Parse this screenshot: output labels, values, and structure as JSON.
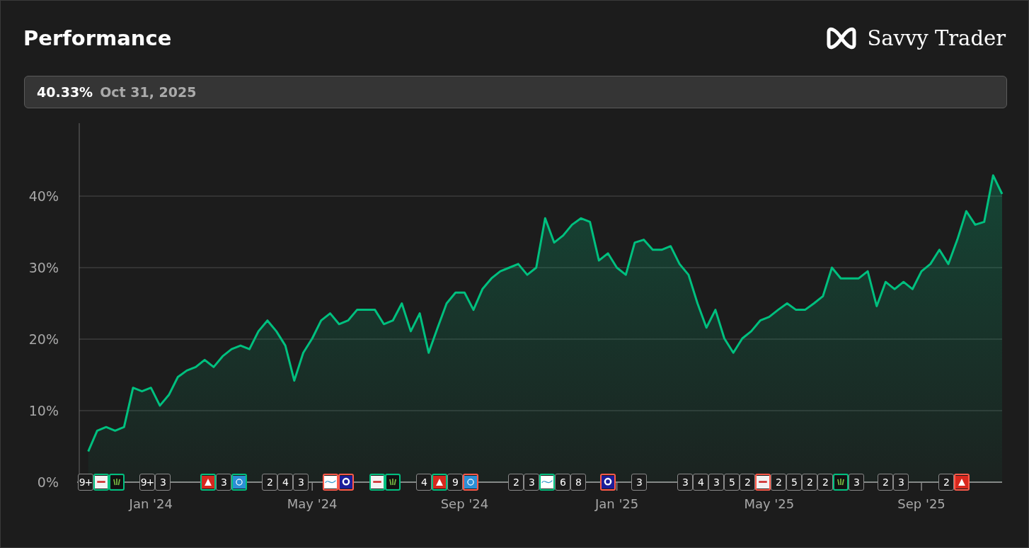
{
  "header": {
    "title": "Performance",
    "brand": "Savvy Trader"
  },
  "summary": {
    "value": "40.33%",
    "date": "Oct 31, 2025"
  },
  "chart": {
    "chart_data": {
      "type": "area",
      "grid": true,
      "ylim": [
        0,
        50
      ],
      "yticks": [
        {
          "value": 0,
          "label": "0%"
        },
        {
          "value": 10,
          "label": "10%"
        },
        {
          "value": 20,
          "label": "20%"
        },
        {
          "value": 30,
          "label": "30%"
        },
        {
          "value": 40,
          "label": "40%"
        }
      ],
      "categories": [
        null,
        null,
        null,
        null,
        null,
        null,
        null,
        null,
        "Jan '24",
        null,
        null,
        null,
        null,
        null,
        null,
        null,
        null,
        null,
        null,
        null,
        null,
        null,
        null,
        null,
        null,
        null,
        "May '24",
        null,
        null,
        null,
        null,
        null,
        null,
        null,
        null,
        null,
        null,
        null,
        null,
        null,
        null,
        null,
        null,
        "Sep '24",
        null,
        null,
        null,
        null,
        null,
        null,
        null,
        null,
        null,
        null,
        null,
        null,
        null,
        null,
        null,
        null,
        "Jan '25",
        null,
        null,
        null,
        null,
        null,
        null,
        null,
        null,
        null,
        null,
        null,
        null,
        null,
        null,
        null,
        null,
        "May '25",
        null,
        null,
        null,
        null,
        null,
        null,
        null,
        null,
        null,
        null,
        null,
        null,
        null,
        null,
        null,
        null,
        "Sep '25",
        null,
        null,
        null,
        null,
        null,
        null,
        null,
        null,
        null
      ],
      "series": [
        {
          "color": "#00c07f",
          "values": [
            null,
            4.3,
            7.2,
            7.7,
            7.2,
            7.7,
            13.2,
            12.7,
            13.2,
            10.7,
            12.2,
            14.7,
            15.6,
            16.1,
            17.1,
            16.1,
            17.6,
            18.6,
            19.1,
            18.6,
            21.1,
            22.6,
            21.1,
            19.1,
            14.2,
            18.1,
            20.1,
            22.6,
            23.6,
            22.1,
            22.6,
            24.1,
            24.1,
            24.1,
            22.1,
            22.6,
            25,
            21.1,
            23.6,
            18.1,
            21.6,
            25,
            26.5,
            26.5,
            24.1,
            27,
            28.5,
            29.5,
            30,
            30.5,
            29,
            30,
            36.9,
            33.5,
            34.5,
            36,
            36.9,
            36.4,
            31,
            32,
            30,
            29,
            33.5,
            33.9,
            32.5,
            32.5,
            33,
            30.5,
            29,
            25,
            21.6,
            24.1,
            20.1,
            18.1,
            20.1,
            21.1,
            22.6,
            23.1,
            24.1,
            25,
            24.1,
            24.1,
            25,
            26,
            30,
            28.5,
            28.5,
            28.5,
            29.5,
            24.6,
            28,
            27,
            28,
            27,
            29.5,
            30.5,
            32.5,
            30.5,
            33.9,
            37.9,
            36,
            36.4,
            42.9,
            40.3
          ]
        }
      ]
    }
  },
  "markers": [
    {
      "tiles": [
        {
          "kind": "count",
          "text": "9+"
        },
        {
          "kind": "logo",
          "color": "#00c07f"
        },
        {
          "kind": "logo",
          "color": "#00c07f"
        }
      ]
    },
    {
      "tiles": [
        {
          "kind": "count",
          "text": "9+"
        },
        {
          "kind": "count",
          "text": "3"
        }
      ]
    },
    {
      "tiles": [
        {
          "kind": "logo",
          "color": "#00c07f"
        },
        {
          "kind": "count",
          "text": "3"
        },
        {
          "kind": "logo",
          "color": "#00c07f"
        }
      ]
    },
    {
      "tiles": [
        {
          "kind": "count",
          "text": "2"
        },
        {
          "kind": "count",
          "text": "4"
        },
        {
          "kind": "count",
          "text": "3"
        }
      ]
    },
    {
      "tiles": [
        {
          "kind": "logo",
          "color": "#ff5a4a"
        },
        {
          "kind": "logo",
          "color": "#ff5a4a"
        }
      ]
    },
    {
      "tiles": [
        {
          "kind": "logo",
          "color": "#00c07f"
        },
        {
          "kind": "logo",
          "color": "#00c07f"
        }
      ]
    },
    {
      "tiles": [
        {
          "kind": "count",
          "text": "4"
        },
        {
          "kind": "logo",
          "color": "#00c07f"
        },
        {
          "kind": "count",
          "text": "9"
        },
        {
          "kind": "logo",
          "color": "#ff5a4a"
        }
      ]
    },
    {
      "tiles": [
        {
          "kind": "count",
          "text": "2"
        },
        {
          "kind": "count",
          "text": "3"
        },
        {
          "kind": "logo",
          "color": "#00c07f"
        },
        {
          "kind": "count",
          "text": "6"
        },
        {
          "kind": "count",
          "text": "8"
        }
      ]
    },
    {
      "tiles": [
        {
          "kind": "logo",
          "color": "#ff5a4a"
        }
      ]
    },
    {
      "tiles": [
        {
          "kind": "count",
          "text": "3"
        }
      ]
    },
    {
      "tiles": [
        {
          "kind": "count",
          "text": "3"
        },
        {
          "kind": "count",
          "text": "4"
        },
        {
          "kind": "count",
          "text": "3"
        },
        {
          "kind": "count",
          "text": "5"
        },
        {
          "kind": "count",
          "text": "2"
        },
        {
          "kind": "logo",
          "color": "#ff5a4a"
        },
        {
          "kind": "count",
          "text": "2"
        },
        {
          "kind": "count",
          "text": "5"
        },
        {
          "kind": "count",
          "text": "2"
        },
        {
          "kind": "count",
          "text": "2"
        },
        {
          "kind": "logo",
          "color": "#00c07f"
        },
        {
          "kind": "count",
          "text": "3"
        }
      ]
    },
    {
      "tiles": [
        {
          "kind": "count",
          "text": "2"
        },
        {
          "kind": "count",
          "text": "3"
        }
      ]
    },
    {
      "tiles": [
        {
          "kind": "count",
          "text": "2"
        },
        {
          "kind": "logo",
          "color": "#ff5a4a"
        }
      ]
    }
  ]
}
